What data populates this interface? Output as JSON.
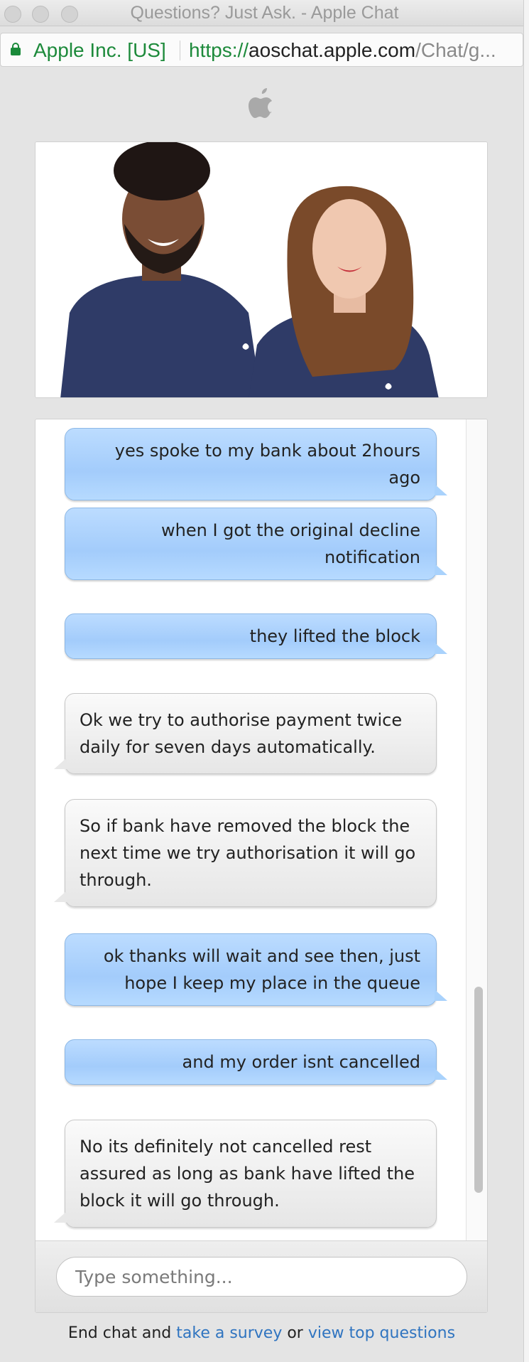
{
  "window": {
    "title": "Questions? Just Ask. - Apple Chat"
  },
  "addressbar": {
    "ev_label": "Apple Inc. [US]",
    "url_scheme": "https://",
    "url_host": "aoschat.apple.com",
    "url_path": "/Chat/g..."
  },
  "messages": [
    {
      "sender": "user",
      "text": "yes spoke to my bank about 2hours ago"
    },
    {
      "sender": "user",
      "text": "when I got the original decline notification"
    },
    {
      "sender": "user",
      "text": "they lifted the block"
    },
    {
      "sender": "agent",
      "text": "Ok we try to authorise payment twice daily for seven days automatically."
    },
    {
      "sender": "agent",
      "text": "So if bank have removed the block the next time we try authorisation it will go through."
    },
    {
      "sender": "user",
      "text": "ok thanks will wait and see then, just hope I keep my place in the queue"
    },
    {
      "sender": "user",
      "text": "and my order isnt cancelled"
    },
    {
      "sender": "agent",
      "text": "No its definitely not cancelled rest assured as long as bank have lifted the block it will go through."
    }
  ],
  "composer": {
    "placeholder": "Type something..."
  },
  "footer": {
    "prefix": "End chat and ",
    "survey_link": "take a survey",
    "middle": " or ",
    "questions_link": "view top questions"
  },
  "colors": {
    "user_bubble": "#a3ccfb",
    "agent_bubble": "#e6e6e6",
    "link": "#2f74c0",
    "secure_green": "#1d8a3b"
  }
}
